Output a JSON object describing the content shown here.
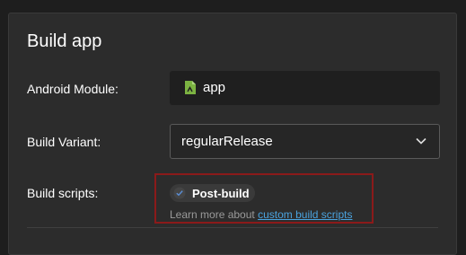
{
  "panel": {
    "title": "Build app"
  },
  "android_module": {
    "label": "Android Module:",
    "value": "app",
    "icon": "android-app-icon"
  },
  "build_variant": {
    "label": "Build Variant:",
    "selected": "regularRelease",
    "icon": "chevron-down-icon"
  },
  "build_scripts": {
    "label": "Build scripts:",
    "chip_label": "Post-build",
    "chip_icon": "checkmark-icon",
    "learn_more_text": "Learn more about",
    "learn_more_link": "custom build scripts"
  },
  "colors": {
    "background": "#1e1e1e",
    "panel": "#2c2c2c",
    "link": "#4aa3df",
    "highlight_border": "#8b1a1a"
  }
}
